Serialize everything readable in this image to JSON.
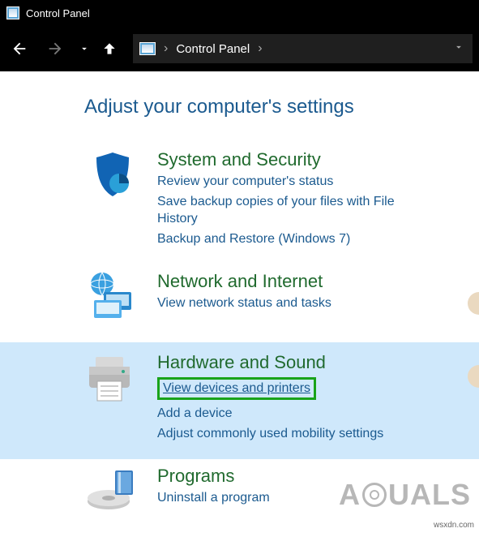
{
  "window": {
    "title": "Control Panel"
  },
  "breadcrumb": {
    "label": "Control Panel"
  },
  "heading": "Adjust your computer's settings",
  "categories": {
    "system": {
      "title": "System and Security",
      "links": [
        "Review your computer's status",
        "Save backup copies of your files with File History",
        "Backup and Restore (Windows 7)"
      ]
    },
    "network": {
      "title": "Network and Internet",
      "links": [
        "View network status and tasks"
      ]
    },
    "hardware": {
      "title": "Hardware and Sound",
      "links": [
        "View devices and printers",
        "Add a device",
        "Adjust commonly used mobility settings"
      ]
    },
    "programs": {
      "title": "Programs",
      "links": [
        "Uninstall a program"
      ]
    }
  },
  "watermark": {
    "prefix": "A",
    "suffix": "UALS"
  },
  "source": "wsxdn.com"
}
